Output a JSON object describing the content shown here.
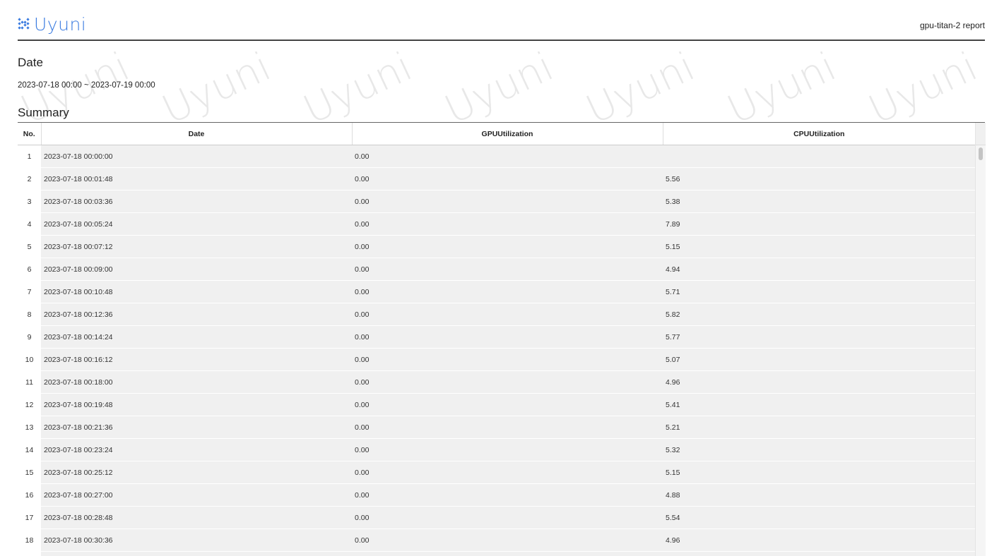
{
  "header": {
    "logo_text": "Uyuni",
    "report_title": "gpu-titan-2 report"
  },
  "watermark_text": "Uyuni",
  "date_section": {
    "title": "Date",
    "range": "2023-07-18 00:00 ~ 2023-07-19 00:00"
  },
  "summary": {
    "title": "Summary",
    "columns": [
      "No.",
      "Date",
      "GPUUtilization",
      "CPUUtilization"
    ],
    "rows": [
      {
        "no": "1",
        "date": "2023-07-18 00:00:00",
        "gpu": "0.00",
        "cpu": ""
      },
      {
        "no": "2",
        "date": "2023-07-18 00:01:48",
        "gpu": "0.00",
        "cpu": "5.56"
      },
      {
        "no": "3",
        "date": "2023-07-18 00:03:36",
        "gpu": "0.00",
        "cpu": "5.38"
      },
      {
        "no": "4",
        "date": "2023-07-18 00:05:24",
        "gpu": "0.00",
        "cpu": "7.89"
      },
      {
        "no": "5",
        "date": "2023-07-18 00:07:12",
        "gpu": "0.00",
        "cpu": "5.15"
      },
      {
        "no": "6",
        "date": "2023-07-18 00:09:00",
        "gpu": "0.00",
        "cpu": "4.94"
      },
      {
        "no": "7",
        "date": "2023-07-18 00:10:48",
        "gpu": "0.00",
        "cpu": "5.71"
      },
      {
        "no": "8",
        "date": "2023-07-18 00:12:36",
        "gpu": "0.00",
        "cpu": "5.82"
      },
      {
        "no": "9",
        "date": "2023-07-18 00:14:24",
        "gpu": "0.00",
        "cpu": "5.77"
      },
      {
        "no": "10",
        "date": "2023-07-18 00:16:12",
        "gpu": "0.00",
        "cpu": "5.07"
      },
      {
        "no": "11",
        "date": "2023-07-18 00:18:00",
        "gpu": "0.00",
        "cpu": "4.96"
      },
      {
        "no": "12",
        "date": "2023-07-18 00:19:48",
        "gpu": "0.00",
        "cpu": "5.41"
      },
      {
        "no": "13",
        "date": "2023-07-18 00:21:36",
        "gpu": "0.00",
        "cpu": "5.21"
      },
      {
        "no": "14",
        "date": "2023-07-18 00:23:24",
        "gpu": "0.00",
        "cpu": "5.32"
      },
      {
        "no": "15",
        "date": "2023-07-18 00:25:12",
        "gpu": "0.00",
        "cpu": "5.15"
      },
      {
        "no": "16",
        "date": "2023-07-18 00:27:00",
        "gpu": "0.00",
        "cpu": "4.88"
      },
      {
        "no": "17",
        "date": "2023-07-18 00:28:48",
        "gpu": "0.00",
        "cpu": "5.54"
      },
      {
        "no": "18",
        "date": "2023-07-18 00:30:36",
        "gpu": "0.00",
        "cpu": "4.96"
      },
      {
        "no": "",
        "date": "",
        "gpu": "",
        "cpu": ""
      }
    ]
  },
  "colors": {
    "brand": "#3a7be0",
    "row_background": "#f0f0f0",
    "watermark": "#e8e8e8"
  },
  "icons": {
    "logo": "uyuni-logo-icon"
  }
}
